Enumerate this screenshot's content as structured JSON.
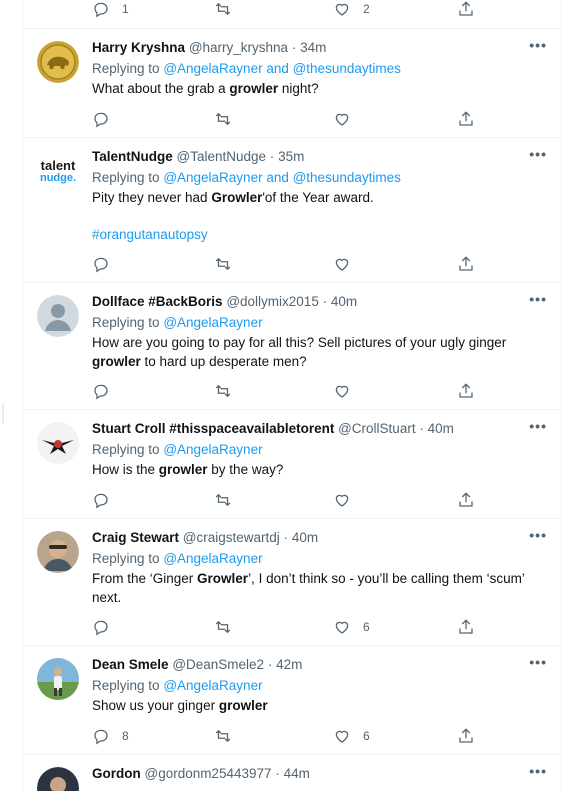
{
  "top_bar": {
    "reply_count": "1",
    "retweet_count": "",
    "like_count": "2"
  },
  "tweets": [
    {
      "name": "Harry Kryshna",
      "handle": "@harry_kryshna",
      "time": "34m",
      "replying_prefix": "Replying to",
      "replying_to": "@AngelaRayner and @thesundaytimes",
      "body_html": "What about the grab a <b>growler</b> night?",
      "hashtag": "",
      "reply_count": "",
      "retweet_count": "",
      "like_count": ""
    },
    {
      "name": "TalentNudge",
      "handle": "@TalentNudge",
      "time": "35m",
      "replying_prefix": "Replying to",
      "replying_to": "@AngelaRayner and @thesundaytimes",
      "body_html": "Pity they never had <b>Growler</b>'of the Year award.",
      "hashtag": "#orangutanautopsy",
      "reply_count": "",
      "retweet_count": "",
      "like_count": ""
    },
    {
      "name": "Dollface #BackBoris",
      "handle": "@dollymix2015",
      "time": "40m",
      "replying_prefix": "Replying to",
      "replying_to": "@AngelaRayner",
      "body_html": "How are you going to pay for all this? Sell pictures of your ugly ginger <b>growler</b> to hard up desperate men?",
      "hashtag": "",
      "reply_count": "",
      "retweet_count": "",
      "like_count": ""
    },
    {
      "name": "Stuart Croll #thisspaceavailabletorent",
      "handle": "@CrollStuart",
      "time": "40m",
      "replying_prefix": "Replying to",
      "replying_to": "@AngelaRayner",
      "body_html": "How is the <b>growler</b> by the way?",
      "hashtag": "",
      "reply_count": "",
      "retweet_count": "",
      "like_count": ""
    },
    {
      "name": "Craig Stewart",
      "handle": "@craigstewartdj",
      "time": "40m",
      "replying_prefix": "Replying to",
      "replying_to": "@AngelaRayner",
      "body_html": "From the ‘Ginger <b>Growler</b>’, I don’t think so - you’ll be calling them ‘scum’ next.",
      "hashtag": "",
      "reply_count": "",
      "retweet_count": "",
      "like_count": "6"
    },
    {
      "name": "Dean Smele",
      "handle": "@DeanSmele2",
      "time": "42m",
      "replying_prefix": "Replying to",
      "replying_to": "@AngelaRayner",
      "body_html": "Show us your ginger <b>growler</b>",
      "hashtag": "",
      "reply_count": "8",
      "retweet_count": "",
      "like_count": "6"
    },
    {
      "name": "Gordon",
      "handle": "@gordonm25443977",
      "time": "44m",
      "replying_prefix": "",
      "replying_to": "",
      "body_html": "",
      "hashtag": "",
      "reply_count": "",
      "retweet_count": "",
      "like_count": ""
    }
  ],
  "ui": {
    "dot": "·",
    "more_icon_text": "•••"
  },
  "icons": {
    "reply": "reply-icon",
    "retweet": "retweet-icon",
    "like": "like-icon",
    "share": "share-icon",
    "more": "more-icon",
    "avatars": [
      "gold-coin-bison-avatar",
      "talentnudge-logo-avatar",
      "default-person-avatar",
      "bird-emblem-avatar",
      "photo-person-avatar",
      "photo-person-avatar",
      "photo-person-avatar"
    ]
  },
  "colors": {
    "link": "#1d9bf0",
    "secondary_text": "#536471",
    "divider": "#eff3f4"
  }
}
